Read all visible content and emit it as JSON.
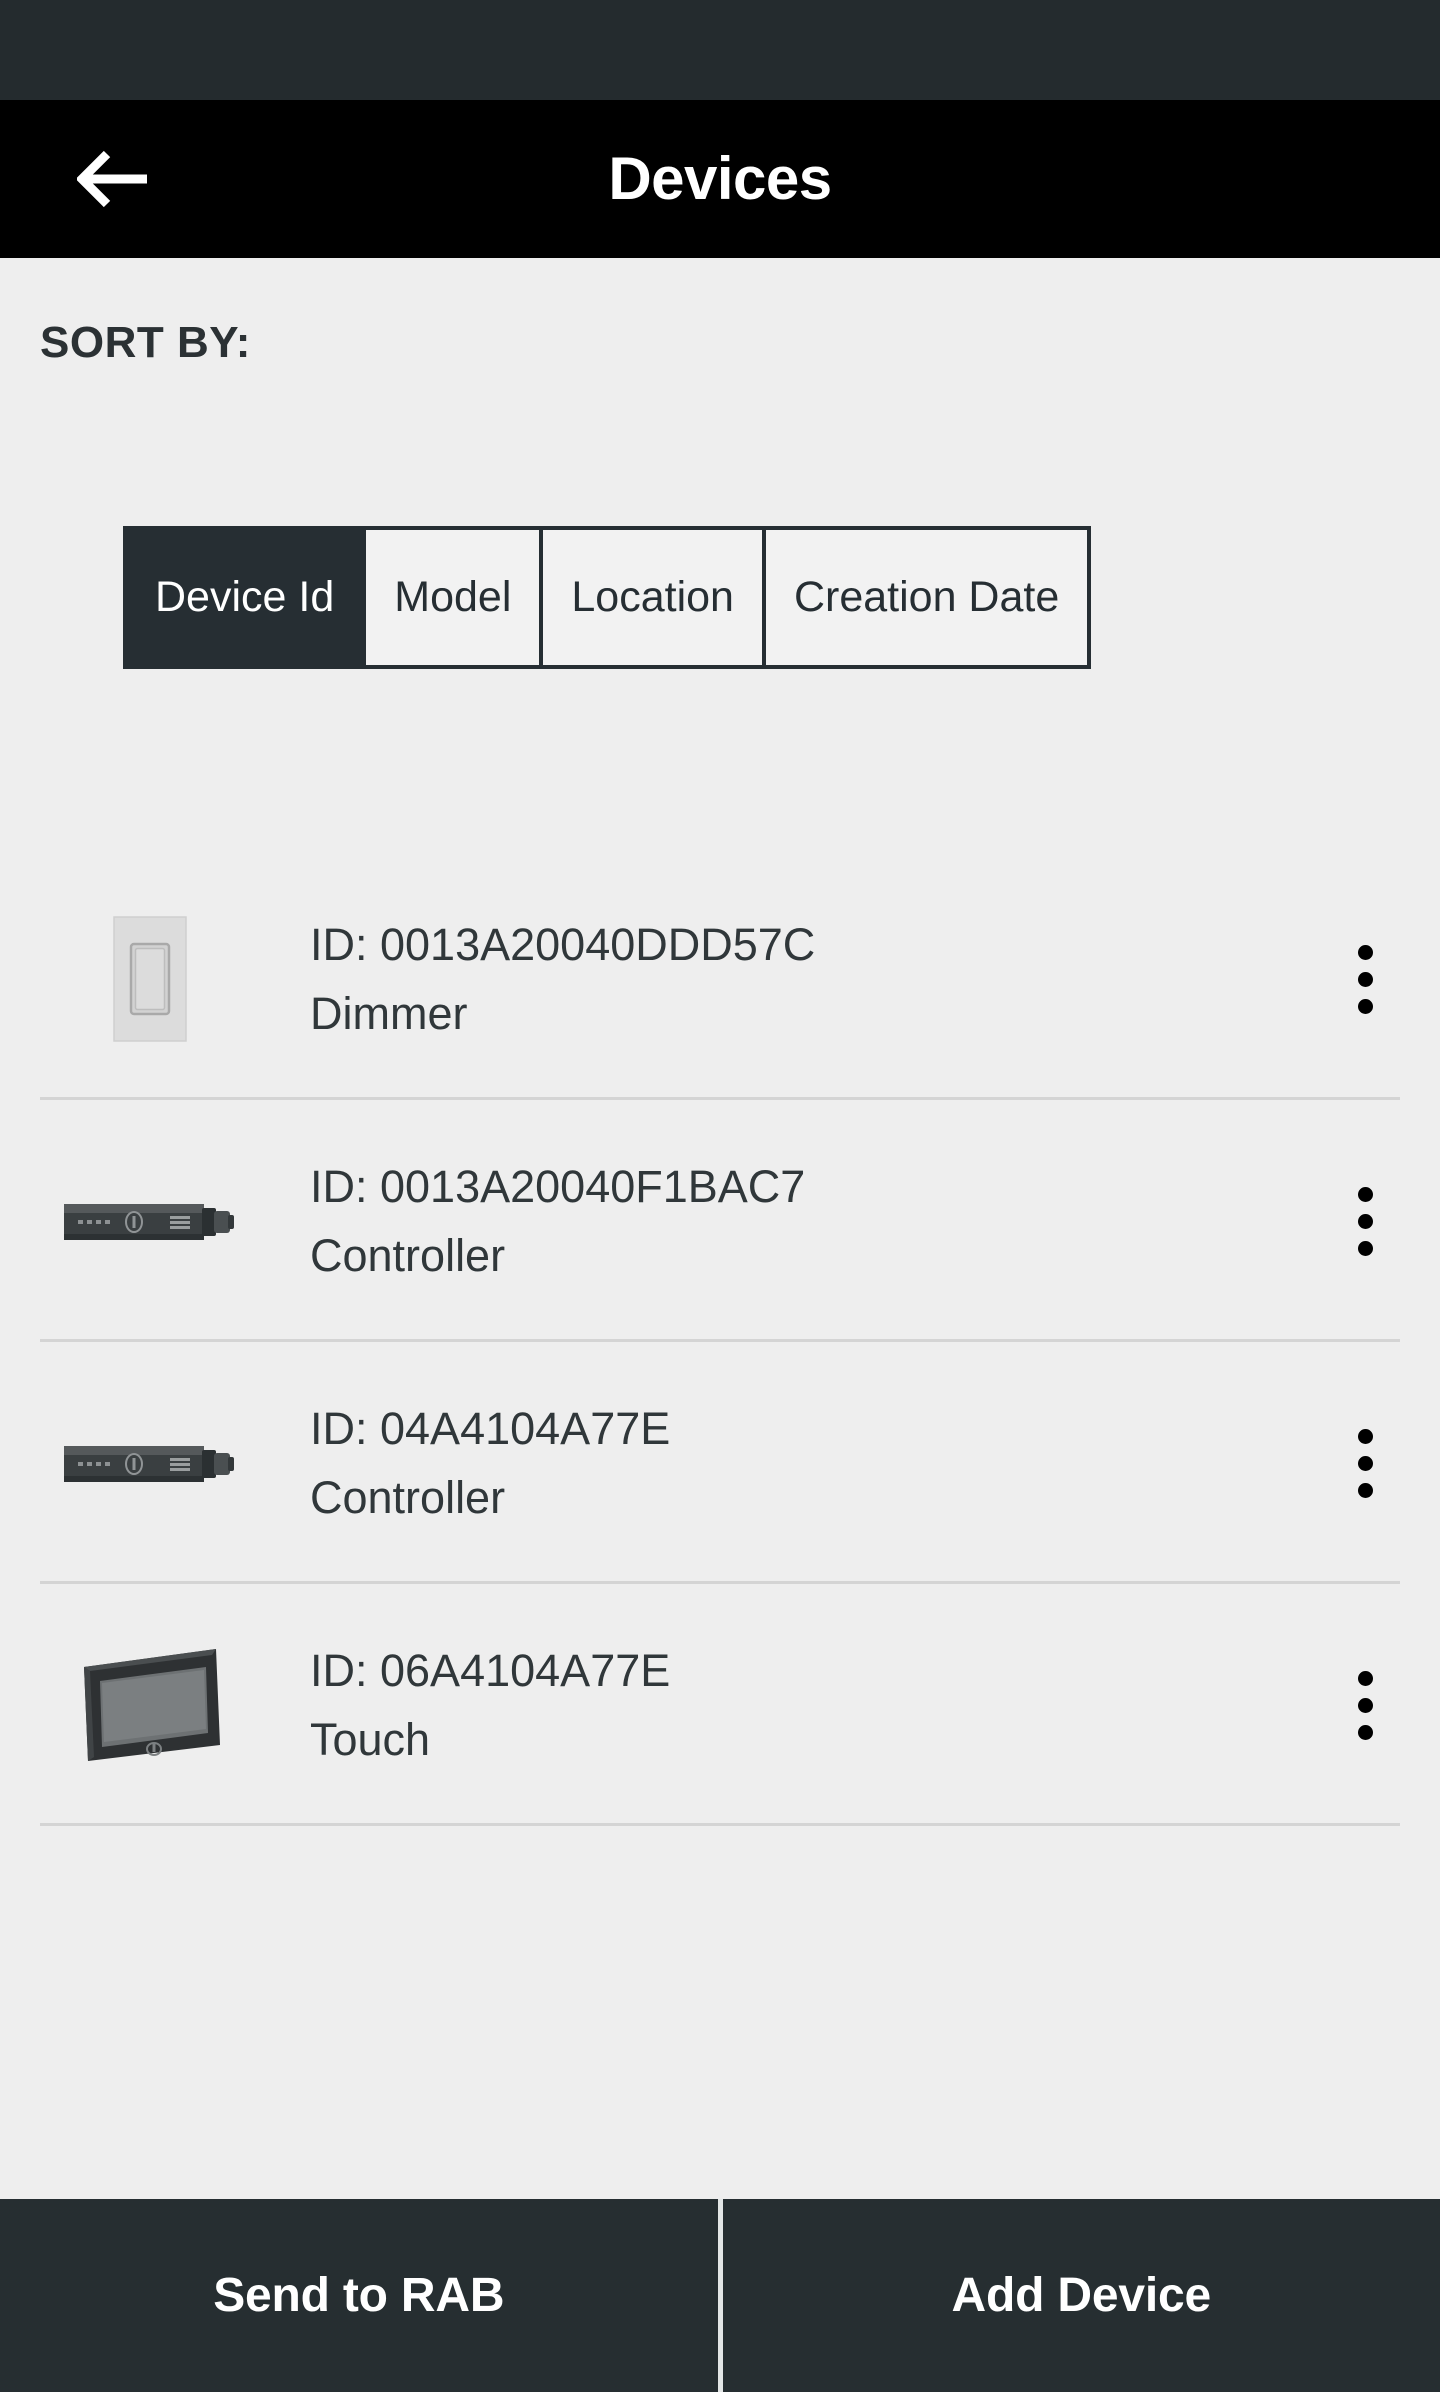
{
  "status_bar": {
    "background": "#242b2e"
  },
  "header": {
    "title": "Devices",
    "back_icon": "arrow-left-icon",
    "background": "#000000",
    "text_color": "#ffffff"
  },
  "sort": {
    "label": "SORT BY:",
    "options": [
      {
        "label": "Device Id",
        "selected": true
      },
      {
        "label": "Model",
        "selected": false
      },
      {
        "label": "Location",
        "selected": false
      },
      {
        "label": "Creation Date",
        "selected": false
      }
    ],
    "active_background": "#262e33",
    "inactive_background": "#f2f2f2"
  },
  "devices": [
    {
      "id_label": "ID: 0013A20040DDD57C",
      "type": "Dimmer",
      "icon": "dimmer-switch-icon",
      "menu_icon": "overflow-menu-icon"
    },
    {
      "id_label": "ID: 0013A20040F1BAC7",
      "type": "Controller",
      "icon": "controller-device-icon",
      "menu_icon": "overflow-menu-icon"
    },
    {
      "id_label": "ID: 04A4104A77E",
      "type": "Controller",
      "icon": "controller-device-icon",
      "menu_icon": "overflow-menu-icon"
    },
    {
      "id_label": "ID: 06A4104A77E",
      "type": "Touch",
      "icon": "touch-panel-icon",
      "menu_icon": "overflow-menu-icon"
    }
  ],
  "bottom_bar": {
    "background": "#262e31",
    "send_label": "Send to RAB",
    "add_label": "Add Device"
  }
}
